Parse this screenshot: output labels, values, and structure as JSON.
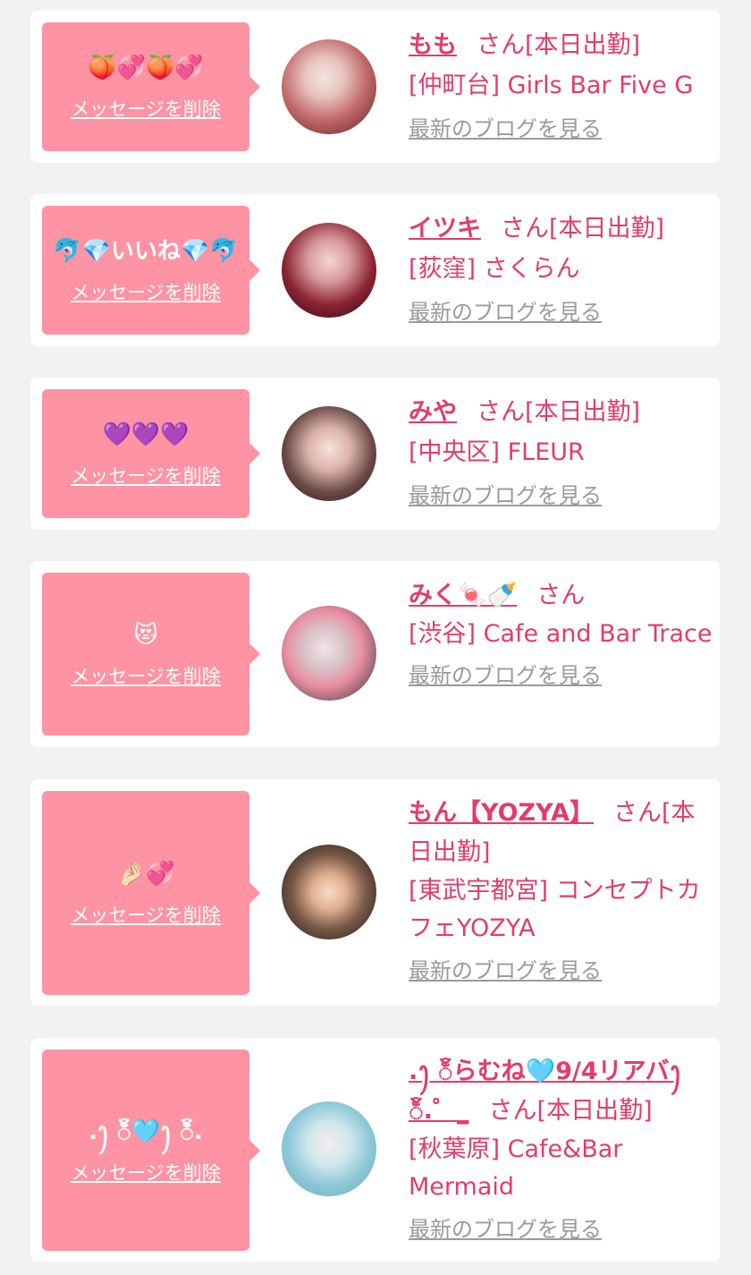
{
  "labels": {
    "delete_message": "メッセージを削除",
    "latest_blog": "最新のブログを見る"
  },
  "colors": {
    "page_background": "#f2f2f2",
    "card_background": "#ffffff",
    "bubble_background": "#fd93a3",
    "accent_pink": "#e23c6a",
    "muted_gray": "#9a9a9a"
  },
  "entries": [
    {
      "message": "🍑💞🍑💞",
      "name": "もも",
      "suffix": "さん[本日出勤]",
      "shop": "[仲町台] Girls Bar Five G"
    },
    {
      "message": "🐬💎いいね💎🐬",
      "name": "イツキ",
      "suffix": "さん[本日出勤]",
      "shop": "[荻窪] さくらん"
    },
    {
      "message": "💜💜💜",
      "name": "みや",
      "suffix": "さん[本日出勤]",
      "shop": "[中央区] FLEUR"
    },
    {
      "message": "😻",
      "name": "みく🍬🍼",
      "suffix": "さん",
      "shop": "[渋谷] Cafe and Bar Trace"
    },
    {
      "message": "🤌🏻💞",
      "name": "もん【YOZYA】",
      "suffix": "さん[本日出勤]",
      "shop": "[東武宇都宮] コンセプトカフェYOZYA"
    },
    {
      "message": ".ꫂ ၴႅၴ🩵ꫂ ၴႅၴ.",
      "name": ".ꫂ ၴႅၴらむね🩵9/4リアバꫂ ၴႅၴ.゜_",
      "suffix": "さん[本日出勤]",
      "shop": "[秋葉原] Cafe&Bar Mermaid"
    }
  ]
}
